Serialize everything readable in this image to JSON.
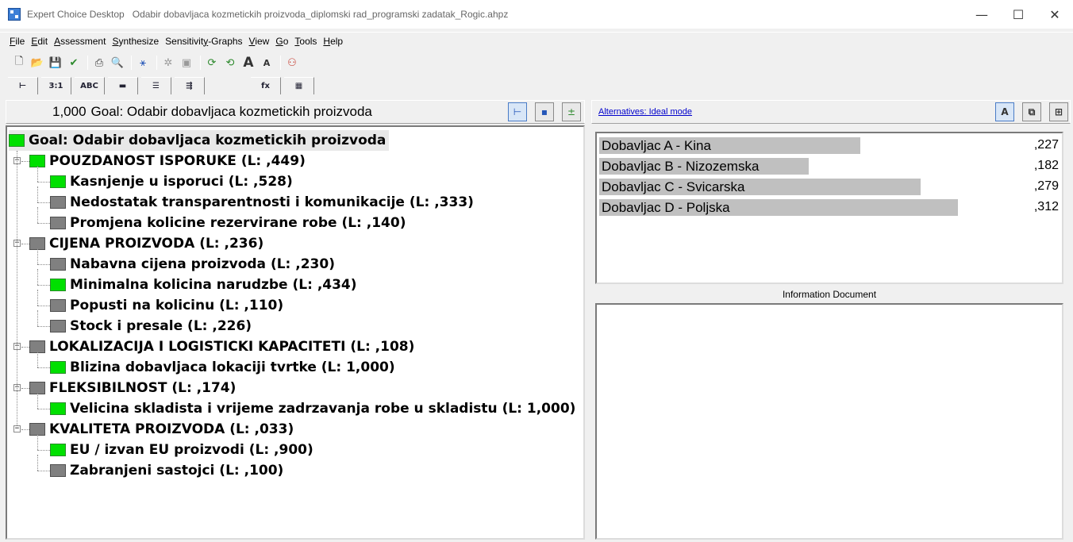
{
  "window": {
    "app_name": "Expert Choice Desktop",
    "file_title": "Odabir dobavljaca kozmetickih proizvoda_diplomski rad_programski zadatak_Rogic.ahpz",
    "minimize": "—",
    "maximize": "☐",
    "close": "✕"
  },
  "menu": [
    {
      "label": "File",
      "u": "F",
      "rest": "ile"
    },
    {
      "label": "Edit",
      "u": "E",
      "rest": "dit"
    },
    {
      "label": "Assessment",
      "u": "A",
      "rest": "ssessment"
    },
    {
      "label": "Synthesize",
      "u": "S",
      "rest": "ynthesize"
    },
    {
      "label": "Sensitivity-Graphs",
      "pre": "Sensitivit",
      "u": "y",
      "rest": "-Graphs"
    },
    {
      "label": "View",
      "u": "V",
      "rest": "iew"
    },
    {
      "label": "Go",
      "u": "G",
      "rest": "o"
    },
    {
      "label": "Tools",
      "u": "T",
      "rest": "ools"
    },
    {
      "label": "Help",
      "u": "H",
      "rest": "elp"
    }
  ],
  "toolbar_icons": [
    "new-file-icon",
    "open-folder-icon",
    "save-icon",
    "checkmark-icon",
    "print-icon",
    "print-preview-icon",
    "hierarchy-icon",
    "cluster-icon",
    "grey-tool-icon",
    "refresh-icon",
    "refresh-alt-icon",
    "font-larger-icon",
    "font-smaller-icon",
    "people-icon"
  ],
  "view_tabs": [
    {
      "name": "tree-view-tab",
      "label": "⊢"
    },
    {
      "name": "pairwise-numeric-tab",
      "label": "3:1"
    },
    {
      "name": "verbal-tab",
      "label": "ABC"
    },
    {
      "name": "graphical-tab",
      "label": "▬"
    },
    {
      "name": "questionnaire-tab",
      "label": "☰"
    },
    {
      "name": "direct-tab",
      "label": "⇶"
    },
    {
      "name": "formula-tab",
      "label": "fx"
    },
    {
      "name": "grid-tab",
      "label": "▦"
    }
  ],
  "goal_header": {
    "priority": "1,000",
    "title": "Goal: Odabir dobavljaca kozmetickih proizvoda"
  },
  "tree": {
    "goal": "Goal: Odabir dobavljaca kozmetickih proizvoda",
    "nodes": [
      {
        "label": "POUZDANOST ISPORUKE (L: ,449)",
        "level": 1,
        "color": "green"
      },
      {
        "label": "Kasnjenje u isporuci (L: ,528)",
        "level": 2,
        "color": "green"
      },
      {
        "label": "Nedostatak transparentnosti i komunikacije (L: ,333)",
        "level": 2,
        "color": "grey"
      },
      {
        "label": "Promjena kolicine rezervirane robe (L: ,140)",
        "level": 2,
        "color": "grey"
      },
      {
        "label": "CIJENA PROIZVODA (L: ,236)",
        "level": 1,
        "color": "grey"
      },
      {
        "label": "Nabavna cijena proizvoda (L: ,230)",
        "level": 2,
        "color": "grey"
      },
      {
        "label": "Minimalna kolicina narudzbe (L: ,434)",
        "level": 2,
        "color": "green"
      },
      {
        "label": "Popusti na kolicinu (L: ,110)",
        "level": 2,
        "color": "grey"
      },
      {
        "label": "Stock i presale (L: ,226)",
        "level": 2,
        "color": "grey"
      },
      {
        "label": "LOKALIZACIJA I LOGISTICKI KAPACITETI (L: ,108)",
        "level": 1,
        "color": "grey"
      },
      {
        "label": "Blizina dobavljaca lokaciji tvrtke (L: 1,000)",
        "level": 2,
        "color": "green"
      },
      {
        "label": "FLEKSIBILNOST (L: ,174)",
        "level": 1,
        "color": "grey"
      },
      {
        "label": "Velicina skladista i vrijeme zadrzavanja robe u skladistu (L: 1,000)",
        "level": 2,
        "color": "green"
      },
      {
        "label": "KVALITETA PROIZVODA (L: ,033)",
        "level": 1,
        "color": "grey"
      },
      {
        "label": "EU / izvan EU proizvodi (L: ,900)",
        "level": 2,
        "color": "green"
      },
      {
        "label": "Zabranjeni sastojci (L: ,100)",
        "level": 2,
        "color": "grey"
      }
    ]
  },
  "alternatives": {
    "link_label": "Alternatives: Ideal mode",
    "items": [
      {
        "name": "Dobavljac A - Kina",
        "value": ",227",
        "fraction": 0.227
      },
      {
        "name": "Dobavljac B - Nizozemska",
        "value": ",182",
        "fraction": 0.182
      },
      {
        "name": "Dobavljac C - Svicarska",
        "value": ",279",
        "fraction": 0.279
      },
      {
        "name": "Dobavljac D - Poljska",
        "value": ",312",
        "fraction": 0.312
      }
    ]
  },
  "info_document": {
    "label": "Information Document"
  },
  "colors": {
    "node_green": "#00e000",
    "node_grey": "#808080",
    "alt_bar": "#c0c0c0",
    "link": "#0000cc"
  }
}
